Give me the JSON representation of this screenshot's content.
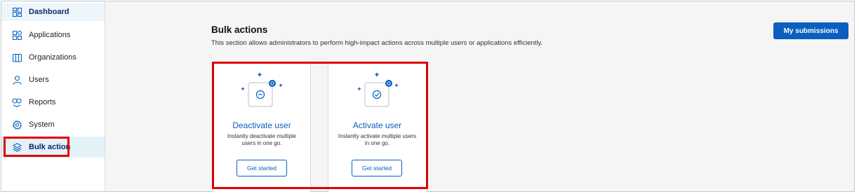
{
  "sidebar": {
    "items": [
      {
        "label": "Dashboard",
        "icon": "dashboard-icon"
      },
      {
        "label": "Applications",
        "icon": "applications-icon"
      },
      {
        "label": "Organizations",
        "icon": "organizations-icon"
      },
      {
        "label": "Users",
        "icon": "user-icon"
      },
      {
        "label": "Reports",
        "icon": "reports-icon"
      },
      {
        "label": "System",
        "icon": "gear-icon"
      },
      {
        "label": "Bulk action",
        "icon": "layers-icon"
      }
    ]
  },
  "header": {
    "title": "Bulk actions",
    "description": "This section allows administrators to perform high-impact actions across multiple users or applications efficiently.",
    "my_submissions_label": "My submissions"
  },
  "cards": [
    {
      "title": "Deactivate user",
      "description": "Instantly deactivate multiple users in one go.",
      "button": "Get started",
      "icon": "minus-circle-icon"
    },
    {
      "title": "Activate user",
      "description": "Instantly activate multiple users in one go.",
      "button": "Get started",
      "icon": "check-circle-icon"
    }
  ],
  "colors": {
    "accent": "#0a5fbf",
    "highlight": "#e00000",
    "active_bg": "#e4f1f9"
  }
}
